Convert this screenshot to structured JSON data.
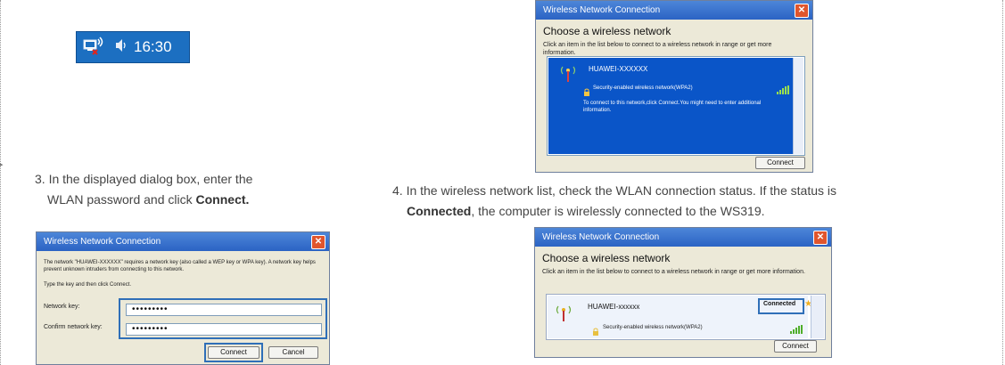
{
  "taskbar": {
    "time": "16:30"
  },
  "steps": {
    "step3_line1": "3. In the displayed dialog box, enter the",
    "step3_line2_pre": "WLAN password and click ",
    "step3_line2_bold": "Connect.",
    "step4_line1": "4. In the wireless network list, check the WLAN connection status. If the status is",
    "step4_line2_bold": "Connected",
    "step4_line2_post": ", the computer is wirelessly connected to the WS319."
  },
  "dialog_top": {
    "title": "Wireless Network Connection",
    "heading": "Choose a wireless network",
    "info": "Click an item in the list below to connect to a wireless network in range or get more information.",
    "network_name": "HUAWEI-XXXXXX",
    "security": "Security-enabled wireless network(WPA2)",
    "hint": "To connect to this network,click Connect.You might need to enter additional information.",
    "connect_button": "Connect"
  },
  "dialog_password": {
    "title": "Wireless Network Connection",
    "message": "The network \"HUAWEI-XXXXXX\" requires a network key (also called a WEP key or WPA key). A network key helps prevent unknown intruders from connecting to this network.",
    "instruction": "Type the key and then click Connect.",
    "network_key_label": "Network key:",
    "network_key_value": "•••••••••",
    "confirm_key_label": "Confirm network key:",
    "confirm_key_value": "•••••••••",
    "connect_button": "Connect",
    "cancel_button": "Cancel"
  },
  "dialog_connected": {
    "title": "Wireless Network Connection",
    "heading": "Choose a wireless network",
    "info": "Click an item in the list below to connect to a wireless network in range or get more information.",
    "network_name": "HUAWEI-xxxxxx",
    "status": "Connected",
    "security": "Security-enabled wireless network(WPA2)",
    "connect_button": "Connect"
  }
}
